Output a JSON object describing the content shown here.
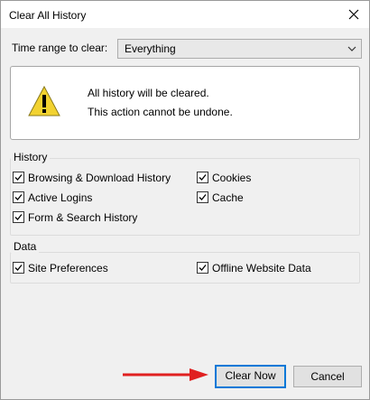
{
  "window": {
    "title": "Clear All History"
  },
  "time_range": {
    "label": "Time range to clear:",
    "selected": "Everything"
  },
  "warning": {
    "line1": "All history will be cleared.",
    "line2": "This action cannot be undone."
  },
  "history_group": {
    "legend": "History",
    "items": [
      {
        "label": "Browsing & Download History",
        "checked": true
      },
      {
        "label": "Cookies",
        "checked": true
      },
      {
        "label": "Active Logins",
        "checked": true
      },
      {
        "label": "Cache",
        "checked": true
      },
      {
        "label": "Form & Search History",
        "checked": true
      }
    ]
  },
  "data_group": {
    "legend": "Data",
    "items": [
      {
        "label": "Site Preferences",
        "checked": true
      },
      {
        "label": "Offline Website Data",
        "checked": true
      }
    ]
  },
  "buttons": {
    "clear_now": "Clear Now",
    "cancel": "Cancel"
  },
  "colors": {
    "focus": "#0078d7",
    "warning_yellow": "#f2d230",
    "annotation_arrow": "#e02020"
  },
  "icons": {
    "close": "close-icon",
    "dropdown": "chevron-down-icon",
    "warning": "warning-icon"
  }
}
